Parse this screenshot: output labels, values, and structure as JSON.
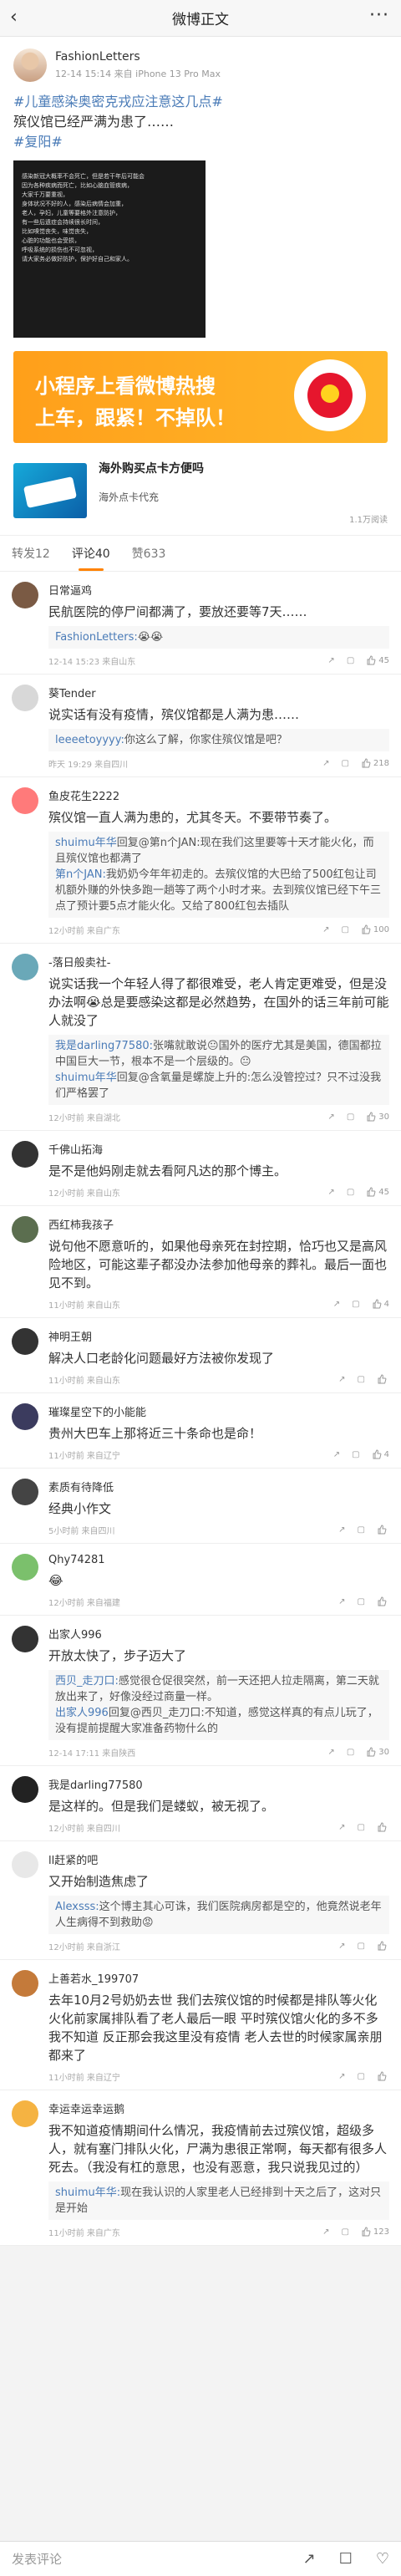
{
  "header": {
    "title": "微博正文",
    "back": "‹",
    "more": "···"
  },
  "post": {
    "author": "FashionLetters",
    "time": "12-14 15:14 来自 iPhone 13 Pro Max",
    "topics": [
      "#儿童感染奥密克戎应注意这几点#"
    ],
    "text": "殡仪馆已经严满为患了……",
    "topic2": "#复阳#",
    "image_lines": [
      "感染新冠大概率不会死亡，但是若干年后可能会",
      "因为各种疾病而死亡，比如心脑血管疾病，",
      "大家千万要重视，",
      "",
      "身体状况不好的人，感染后病情会加重，",
      "老人，孕妇，儿童等要格外注意防护，",
      "",
      "有一些后遗症会持续很长时间，",
      "比如嗅觉丧失，味觉丧失，",
      "心脏的功能也会受损，",
      "",
      "呼吸系统的损伤也不可忽视，",
      "",
      "请大家务必做好防护，保护好自己和家人。"
    ],
    "banner_l1": "小程序上看微博热搜",
    "banner_l2": "上车，跟紧！不掉队！",
    "ad_title": "海外购买点卡方便吗",
    "ad_sub": "海外点卡代充",
    "ad_reads": "1.1万阅读"
  },
  "tabs": [
    "转发12",
    "评论40",
    "赞633"
  ],
  "colors": {
    "accent": "#ff8200",
    "link": "#4a7bb7"
  },
  "comments": [
    {
      "name": "日常逼鸡",
      "text": "民航医院的停尸间都满了，要放还要等7天……",
      "reply": [
        {
          "u": "FashionLetters:",
          "t": "😭😭"
        }
      ],
      "time": "12-14 15:23 来自山东",
      "likes": "45",
      "av": "#7a5a44"
    },
    {
      "name": "葵Tender",
      "text": "说实话有没有疫情，殡仪馆都是人满为患……",
      "reply": [
        {
          "u": "leeeetoyyyy:",
          "t": "你这么了解，你家住殡仪馆是吧？"
        }
      ],
      "time": "昨天 19:29 来自四川",
      "likes": "218",
      "av": "#d8d8d8"
    },
    {
      "name": "鱼皮花生2222",
      "text": "殡仪馆一直人满为患的，尤其冬天。不要带节奏了。",
      "reply": [
        {
          "u": "shuimu年华",
          "t": "回复@第n个JAN:现在我们这里要等十天才能火化，而且殡仪馆也都满了"
        },
        {
          "u": "第n个JAN:",
          "t": "我奶奶今年年初走的。去殡仪馆的大巴给了500红包让司机额外赚的外快多跑一趟等了两个小时才来。去到殡仪馆已经下午三点了预计要5点才能火化。又给了800红包去插队"
        }
      ],
      "time": "12小时前 来自广东",
      "likes": "100",
      "av": "#ff7a7a"
    },
    {
      "name": "-落日般卖社-",
      "text": "说实话我一个年轻人得了都很难受，老人肯定更难受，但是没办法啊😭总是要感染这都是必然趋势，在国外的话三年前可能人就没了",
      "reply": [
        {
          "u": "我是darling77580:",
          "t": "张嘴就敢说😐国外的医疗尤其是美国，德国都拉中国巨大一节，根本不是一个层级的。😐"
        },
        {
          "u": "shuimu年华",
          "t": "回复@含氧量是螺旋上升的:怎么没管控过？只不过没我们严格罢了"
        }
      ],
      "time": "12小时前 来自湖北",
      "likes": "30",
      "av": "#6aa8b8"
    },
    {
      "name": "千佛山拓海",
      "text": "是不是他妈刚走就去看阿凡达的那个博主。",
      "reply": [],
      "time": "12小时前 来自山东",
      "likes": "45",
      "av": "#333"
    },
    {
      "name": "西红柿我孩子",
      "text": "说句他不愿意听的，如果他母亲死在封控期，恰巧也又是高风险地区，可能这辈子都没办法参加他母亲的葬礼。最后一面也见不到。",
      "reply": [],
      "time": "11小时前 来自山东",
      "likes": "4",
      "av": "#5b6e4f"
    },
    {
      "name": "神明王朝",
      "text": "解决人口老龄化问题最好方法被你发现了",
      "reply": [],
      "time": "11小时前 来自山东",
      "likes": "",
      "av": "#333"
    },
    {
      "name": "璀璨星空下的小能能",
      "text": "贵州大巴车上那将近三十条命也是命！",
      "reply": [],
      "time": "11小时前 来自辽宁",
      "likes": "4",
      "av": "#3b3b5e"
    },
    {
      "name": "素质有待降低",
      "text": "经典小作文",
      "reply": [],
      "time": "5小时前 来自四川",
      "likes": "",
      "av": "#444"
    },
    {
      "name": "Qhy74281",
      "text": "😂",
      "reply": [],
      "time": "12小时前 来自福建",
      "likes": "",
      "av": "#7bc06c"
    },
    {
      "name": "出家人996",
      "text": "开放太快了，步子迈大了",
      "reply": [
        {
          "u": "西贝_走刀口:",
          "t": "感觉很仓促很突然，前一天还把人拉走隔离，第二天就放出来了，好像没经过商量一样。"
        },
        {
          "u": "出家人996",
          "t": "回复@西贝_走刀口:不知道，感觉这样真的有点儿玩了，没有提前提醒大家准备药物什么的"
        }
      ],
      "time": "12-14 17:11 来自陕西",
      "likes": "30",
      "av": "#333"
    },
    {
      "name": "我是darling77580",
      "text": "是这样的。但是我们是蝼蚁，被无视了。",
      "reply": [],
      "time": "12小时前 来自四川",
      "likes": "",
      "av": "#222"
    },
    {
      "name": "ll赶紧的吧",
      "text": "又开始制造焦虑了",
      "reply": [
        {
          "u": "Alexsss:",
          "t": "这个博主其心可诛，我们医院病房都是空的，他竟然说老年人生病得不到救助😡"
        }
      ],
      "time": "12小时前 来自浙江",
      "likes": "",
      "av": "#e8e8e8"
    },
    {
      "name": "上善若水_199707",
      "text": "去年10月2号奶奶去世 我们去殡仪馆的时候都是排队等火化 火化前家属排队看了老人最后一眼 平时殡仪馆火化的多不多我不知道 反正那会我这里没有疫情 老人去世的时候家属亲朋都来了",
      "reply": [],
      "time": "11小时前 来自辽宁",
      "likes": "",
      "av": "#c47a3a"
    },
    {
      "name": "幸运幸运幸运鹅",
      "text": "我不知道疫情期间什么情况，我疫情前去过殡仪馆，超级多人，就有塞门排队火化，尸满为患很正常啊，每天都有很多人死去。（我没有杠的意思，也没有恶意，我只说我见过的）",
      "reply": [
        {
          "u": "shuimu年华:",
          "t": "现在我认识的人家里老人已经排到十天之后了，这对只是开始"
        }
      ],
      "time": "11小时前 来自广东",
      "likes": "123",
      "av": "#f5b342"
    }
  ],
  "bottom": {
    "input": "发表评论",
    "icons": [
      "share-icon",
      "comment-icon",
      "like-icon"
    ]
  }
}
